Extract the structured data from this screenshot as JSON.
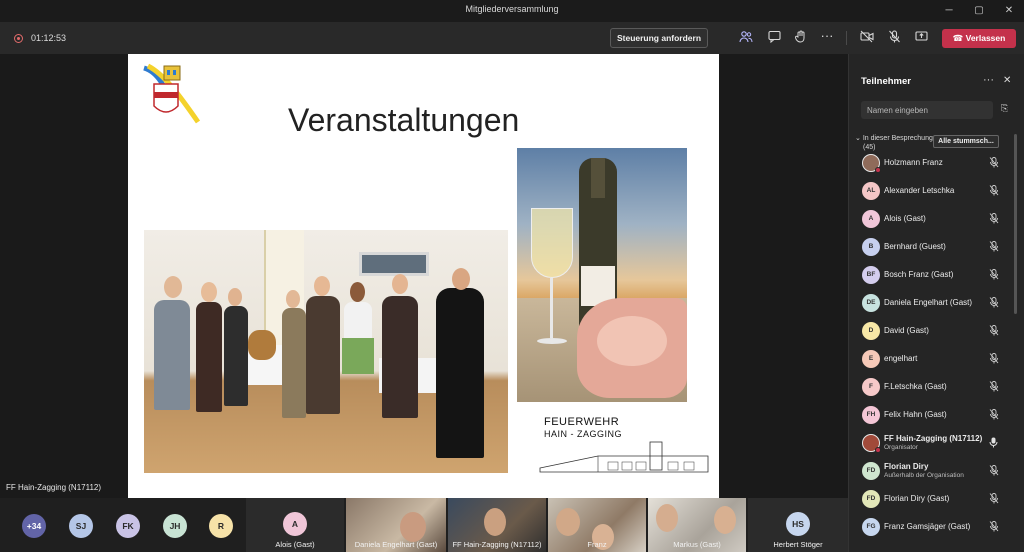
{
  "window": {
    "title": "Mitgliederversammlung",
    "controls": [
      "─",
      "▢",
      "✕"
    ]
  },
  "toolbar": {
    "timer": "01:12:53",
    "control_label": "Steuerung anfordern",
    "leave_label": "Verlassen",
    "icons": [
      "people-icon",
      "chat-icon",
      "raise-hand-icon",
      "more-icon",
      "camera-off-icon",
      "mic-off-icon",
      "share-icon"
    ]
  },
  "slide": {
    "title": "Veranstaltungen",
    "fw_line1": "FEUERWEHR",
    "fw_line2": "HAIN - ZAGGING"
  },
  "presenter_label": "FF Hain-Zagging (N17112)",
  "bottom": {
    "avatars": [
      {
        "initials": "+34",
        "color": "#6264a7",
        "fg": "#ffffff"
      },
      {
        "initials": "SJ",
        "color": "#b4c6e7",
        "fg": "#2b2b2b"
      },
      {
        "initials": "FK",
        "color": "#c9c3e6",
        "fg": "#2b2b2b"
      },
      {
        "initials": "JH",
        "color": "#c8e3d4",
        "fg": "#2b2b2b"
      },
      {
        "initials": "R",
        "color": "#f6e2a8",
        "fg": "#2b2b2b"
      }
    ],
    "tiles": [
      {
        "label": "Alois (Gast)",
        "initials": "A"
      },
      {
        "label": "Daniela Engelhart (Gast)"
      },
      {
        "label": "FF Hain-Zagging (N17112)"
      },
      {
        "label": "Franz"
      },
      {
        "label": "Markus (Gast)"
      },
      {
        "label": "Herbert Stöger",
        "initials": "HS"
      }
    ]
  },
  "panel": {
    "title": "Teilnehmer",
    "search_placeholder": "Namen eingeben",
    "section_line1": "In dieser Besprechung",
    "section_line2": "(45)",
    "mute_all_label": "Alle stummsch...",
    "participants": [
      {
        "initials": "",
        "name": "Holzmann Franz",
        "color": "#8f6b5a",
        "photo": true
      },
      {
        "initials": "AL",
        "name": "Alexander Letschka",
        "color": "#f4c6c6"
      },
      {
        "initials": "A",
        "name": "Alois (Gast)",
        "color": "#f0c6d8"
      },
      {
        "initials": "B",
        "name": "Bernhard (Guest)",
        "color": "#c6cfee"
      },
      {
        "initials": "BF",
        "name": "Bosch Franz (Gast)",
        "color": "#d4cdee"
      },
      {
        "initials": "DE",
        "name": "Daniela Engelhart (Gast)",
        "color": "#c7e2df"
      },
      {
        "initials": "D",
        "name": "David (Gast)",
        "color": "#f7e7a6"
      },
      {
        "initials": "E",
        "name": "engelhart",
        "color": "#f6c9b8"
      },
      {
        "initials": "F",
        "name": "F.Letschka (Gast)",
        "color": "#f6c9c9"
      },
      {
        "initials": "FH",
        "name": "Felix Hahn (Gast)",
        "color": "#f4c6d6"
      },
      {
        "initials": "",
        "name": "FF Hain-Zagging (N17112)",
        "sub": "Organisator",
        "color": "#a14a3a",
        "photo": true,
        "mic_on": true
      },
      {
        "initials": "FD",
        "name": "Florian Diry",
        "sub": "Außerhalb der Organisation",
        "color": "#cfe6cf"
      },
      {
        "initials": "FD",
        "name": "Florian Diry (Gast)",
        "color": "#e2e6b8"
      },
      {
        "initials": "FG",
        "name": "Franz Gamsjäger (Gast)",
        "color": "#c6d6ee"
      }
    ]
  }
}
